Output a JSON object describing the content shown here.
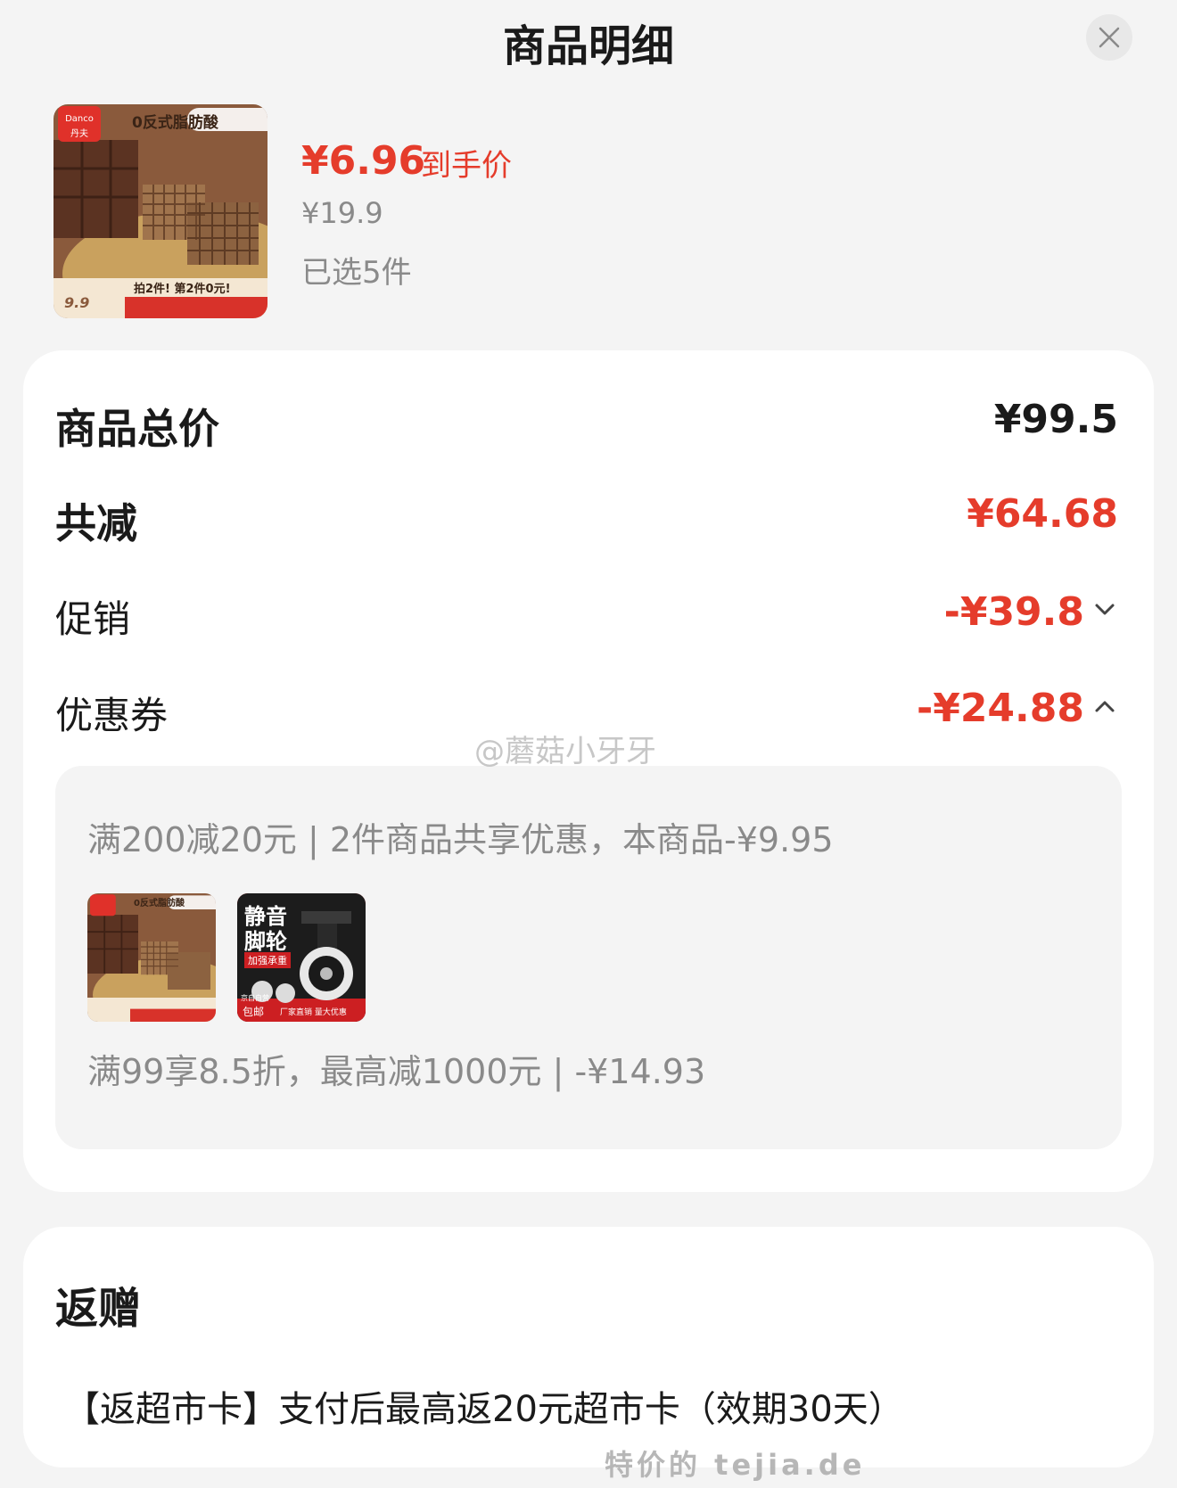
{
  "header": {
    "title": "商品明细",
    "close_icon": "close-icon"
  },
  "product": {
    "price_now": "¥6.96",
    "price_now_label": "到手价",
    "price_original": "¥19.9",
    "selected": "已选5件",
    "image": {
      "icon": "wafer-product-image",
      "badge": "0反式脂肪酸",
      "brand": "Danco",
      "brand_cn": "丹夫",
      "promo": "拍2件! 第2件0元!",
      "price_tag": "9.9"
    }
  },
  "summary": {
    "total_label": "商品总价",
    "total_value": "¥99.5",
    "discount_label": "共减",
    "discount_value": "¥64.68",
    "promo_label": "促销",
    "promo_value": "-¥39.8",
    "coupon_label": "优惠券",
    "coupon_value": "-¥24.88"
  },
  "coupon_details": {
    "line1": "满200减20元 | 2件商品共享优惠，本商品-¥9.95",
    "line2": "满99享8.5折，最高减1000元 | -¥14.93",
    "item2": {
      "icon": "caster-wheel-product-image",
      "title1": "静音",
      "title2": "脚轮",
      "tag": "加强承重",
      "shipping": "京自自营",
      "shipping2": "包邮",
      "banner": "厂家直销 量大优惠"
    }
  },
  "watermark": "@蘑菇小牙牙",
  "gift": {
    "title": "返赠",
    "description": "【返超市卡】支付后最高返20元超市卡（效期30天）"
  },
  "footer_watermark": "特价的 tejia.de",
  "colors": {
    "accent_red": "#e53c2b",
    "muted": "#8a8a8a"
  }
}
